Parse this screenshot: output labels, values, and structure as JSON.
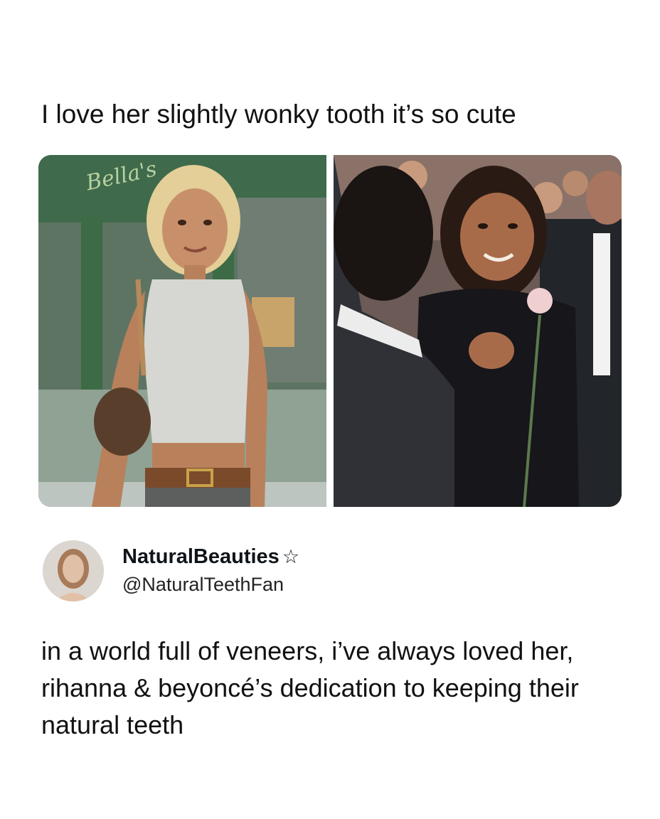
{
  "post": {
    "caption": "I love her slightly wonky tooth it’s so cute"
  },
  "media": {
    "left_photo": {
      "storefront_sign": "Bella's"
    },
    "right_photo": {}
  },
  "tweet": {
    "display_name": "NaturalBeauties",
    "badge_icon": "☆",
    "handle": "@NaturalTeethFan",
    "text": "in a world full of veneers, i’ve always loved her, rihanna & beyoncé’s dedication to keeping their natural teeth"
  },
  "colors": {
    "background": "#ffffff",
    "text": "#111111",
    "shopfront_green": "#3d6b4a"
  }
}
